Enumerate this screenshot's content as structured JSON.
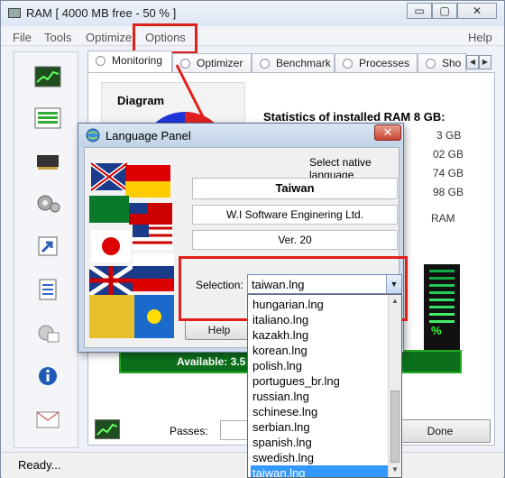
{
  "window": {
    "title": "RAM [ 4000 MB free - 50 % ]",
    "min": "▭",
    "max": "▢",
    "close": "✕"
  },
  "menu": {
    "file": "File",
    "tools": "Tools",
    "optimize": "Optimize",
    "options": "Options",
    "help": "Help"
  },
  "tabs": [
    "Monitoring",
    "Optimizer",
    "Benchmark",
    "Processes",
    "Sho"
  ],
  "main": {
    "diagram": "Diagram",
    "stats_title": "Statistics of installed RAM 8 GB:",
    "stats": [
      "3 GB",
      "02 GB",
      "74 GB",
      "98 GB",
      "RAM"
    ],
    "percent": "%",
    "available": "Available: 3.5",
    "passes": "Passes:",
    "done": "Done"
  },
  "status": {
    "text": "Ready..."
  },
  "dialog": {
    "title": "Language Panel",
    "subtitle": "Select native language",
    "language": "Taiwan",
    "company": "W.I Software Enginering Ltd.",
    "version": "Ver. 20",
    "selection_label": "Selection:",
    "selection_value": "taiwan.lng",
    "help": "Help"
  },
  "list": {
    "items": [
      "hungarian.lng",
      "italiano.lng",
      "kazakh.lng",
      "korean.lng",
      "polish.lng",
      "portugues_br.lng",
      "russian.lng",
      "schinese.lng",
      "serbian.lng",
      "spanish.lng",
      "swedish.lng",
      "taiwan.lng"
    ],
    "selected_index": 11
  },
  "colors": {
    "accent": "#3399ff",
    "highlight": "#e0201a"
  }
}
